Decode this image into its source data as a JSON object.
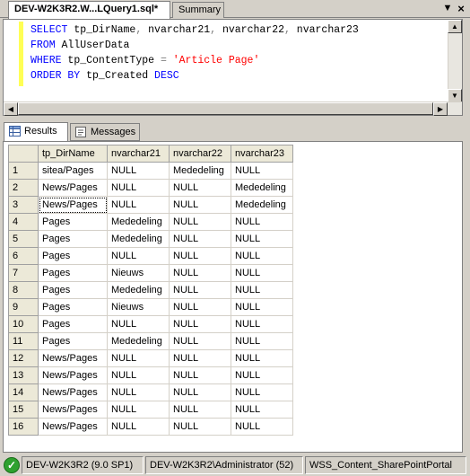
{
  "tabs": {
    "query_tab": "DEV-W2K3R2.W...LQuery1.sql*",
    "summary_tab": "Summary",
    "dropdown_icon": "▼",
    "close_icon": "×"
  },
  "sql": {
    "line1": {
      "kw": "SELECT",
      "rest": " tp_DirName",
      "c1": ",",
      "r2": " nvarchar21",
      "c2": ",",
      "r3": " nvarchar22",
      "c3": ",",
      "r4": " nvarchar23"
    },
    "line2": {
      "kw": "FROM",
      "rest": " AllUserData"
    },
    "line3": {
      "kw": "WHERE",
      "rest": " tp_ContentType ",
      "op": "=",
      "str": " 'Article Page'"
    },
    "line4": {
      "kw": "ORDER BY",
      "rest": " tp_Created ",
      "kw2": "DESC"
    }
  },
  "results_tabs": {
    "results": "Results",
    "messages": "Messages"
  },
  "grid": {
    "columns": [
      "",
      "tp_DirName",
      "nvarchar21",
      "nvarchar22",
      "nvarchar23"
    ],
    "rows": [
      [
        "1",
        "sitea/Pages",
        "NULL",
        "Mededeling",
        "NULL"
      ],
      [
        "2",
        "News/Pages",
        "NULL",
        "NULL",
        "Mededeling"
      ],
      [
        "3",
        "News/Pages",
        "NULL",
        "NULL",
        "Mededeling"
      ],
      [
        "4",
        "Pages",
        "Mededeling",
        "NULL",
        "NULL"
      ],
      [
        "5",
        "Pages",
        "Mededeling",
        "NULL",
        "NULL"
      ],
      [
        "6",
        "Pages",
        "NULL",
        "NULL",
        "NULL"
      ],
      [
        "7",
        "Pages",
        "Nieuws",
        "NULL",
        "NULL"
      ],
      [
        "8",
        "Pages",
        "Mededeling",
        "NULL",
        "NULL"
      ],
      [
        "9",
        "Pages",
        "Nieuws",
        "NULL",
        "NULL"
      ],
      [
        "10",
        "Pages",
        "NULL",
        "NULL",
        "NULL"
      ],
      [
        "11",
        "Pages",
        "Mededeling",
        "NULL",
        "NULL"
      ],
      [
        "12",
        "News/Pages",
        "NULL",
        "NULL",
        "NULL"
      ],
      [
        "13",
        "News/Pages",
        "NULL",
        "NULL",
        "NULL"
      ],
      [
        "14",
        "News/Pages",
        "NULL",
        "NULL",
        "NULL"
      ],
      [
        "15",
        "News/Pages",
        "NULL",
        "NULL",
        "NULL"
      ],
      [
        "16",
        "News/Pages",
        "NULL",
        "NULL",
        "NULL"
      ]
    ]
  },
  "statusbar": {
    "server": "DEV-W2K3R2 (9.0 SP1)",
    "user": "DEV-W2K3R2\\Administrator (52)",
    "database": "WSS_Content_SharePointPortal"
  },
  "colors": {
    "keyword": "#0000ff",
    "string": "#ff0000",
    "status_ok": "#2fa12f"
  }
}
